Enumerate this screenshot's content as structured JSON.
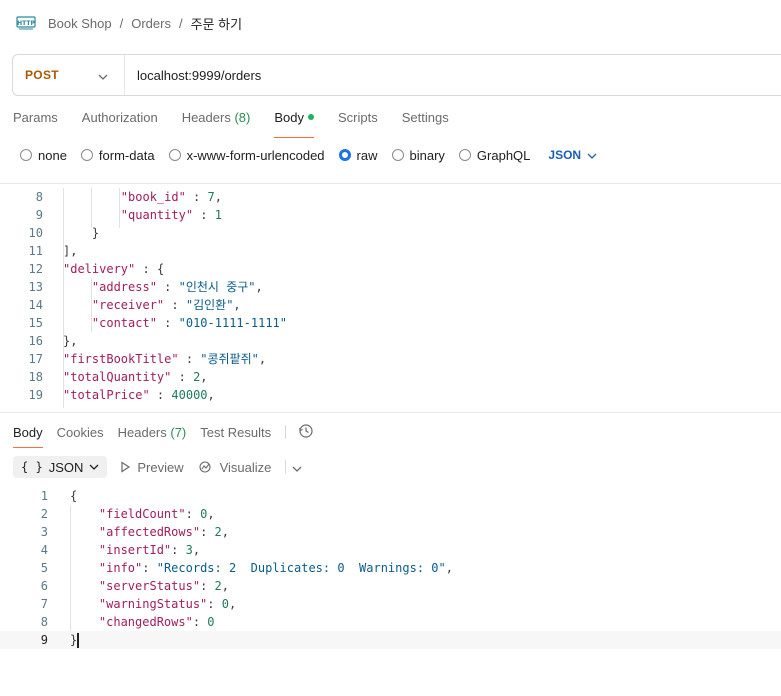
{
  "breadcrumb": {
    "icon": "http-icon",
    "items": [
      "Book Shop",
      "Orders",
      "주문 하기"
    ],
    "separator": "/"
  },
  "request": {
    "method": "POST",
    "url": "localhost:9999/orders"
  },
  "request_tabs": [
    {
      "label": "Params"
    },
    {
      "label": "Authorization"
    },
    {
      "label": "Headers",
      "count": "(8)"
    },
    {
      "label": "Body",
      "active": true
    },
    {
      "label": "Scripts"
    },
    {
      "label": "Settings"
    }
  ],
  "body_options": {
    "radios": [
      "none",
      "form-data",
      "x-www-form-urlencoded",
      "raw",
      "binary",
      "GraphQL"
    ],
    "selected": "raw",
    "format": "JSON"
  },
  "request_body_lines": [
    {
      "num": "8",
      "text": "        \"book_id\" : 7,"
    },
    {
      "num": "9",
      "text": "        \"quantity\" : 1"
    },
    {
      "num": "10",
      "text": "    }"
    },
    {
      "num": "11",
      "text": "],"
    },
    {
      "num": "12",
      "text": "\"delivery\" : {"
    },
    {
      "num": "13",
      "text": "    \"address\" : \"인천시 중구\","
    },
    {
      "num": "14",
      "text": "    \"receiver\" : \"김인환\","
    },
    {
      "num": "15",
      "text": "    \"contact\" : \"010-1111-1111\""
    },
    {
      "num": "16",
      "text": "},"
    },
    {
      "num": "17",
      "text": "\"firstBookTitle\" : \"콩쥐팥쥐\","
    },
    {
      "num": "18",
      "text": "\"totalQuantity\" : 2,"
    },
    {
      "num": "19",
      "text": "\"totalPrice\" : 40000,"
    }
  ],
  "response_tabs": [
    {
      "label": "Body",
      "active": true
    },
    {
      "label": "Cookies"
    },
    {
      "label": "Headers",
      "count": "(7)"
    },
    {
      "label": "Test Results"
    }
  ],
  "response_toolbar": {
    "format_brace": "{ }",
    "format_label": "JSON",
    "preview_label": "Preview",
    "visualize_label": "Visualize"
  },
  "response_lines": [
    {
      "num": "1",
      "text": "{"
    },
    {
      "num": "2",
      "text": "    \"fieldCount\": 0,"
    },
    {
      "num": "3",
      "text": "    \"affectedRows\": 2,"
    },
    {
      "num": "4",
      "text": "    \"insertId\": 3,"
    },
    {
      "num": "5",
      "text": "    \"info\": \"Records: 2  Duplicates: 0  Warnings: 0\","
    },
    {
      "num": "6",
      "text": "    \"serverStatus\": 2,"
    },
    {
      "num": "7",
      "text": "    \"warningStatus\": 0,"
    },
    {
      "num": "8",
      "text": "    \"changedRows\": 0"
    },
    {
      "num": "9",
      "text": "}"
    }
  ],
  "colors": {
    "method": "#a85b00",
    "accent": "#ff6c37",
    "json_select": "#1a5fb4",
    "radio_checked": "#1a73e8",
    "body_dot": "#1bb45a"
  }
}
